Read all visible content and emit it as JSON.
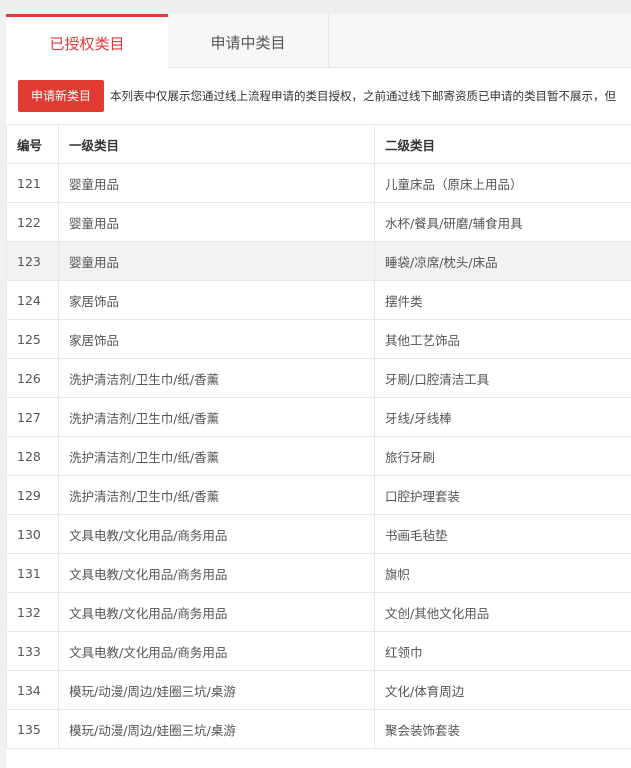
{
  "tabs": [
    {
      "label": "已授权类目",
      "active": true
    },
    {
      "label": "申请中类目",
      "active": false
    }
  ],
  "toolbar": {
    "apply_label": "申请新类目",
    "notice": "本列表中仅展示您通过线上流程申请的类目授权，之前通过线下邮寄资质已申请的类目暂不展示，但"
  },
  "table": {
    "headers": [
      "编号",
      "一级类目",
      "二级类目"
    ],
    "rows": [
      {
        "id": "121",
        "level1": "婴童用品",
        "level2": "儿童床品（原床上用品）"
      },
      {
        "id": "122",
        "level1": "婴童用品",
        "level2": "水杯/餐具/研磨/辅食用具"
      },
      {
        "id": "123",
        "level1": "婴童用品",
        "level2": "睡袋/凉席/枕头/床品"
      },
      {
        "id": "124",
        "level1": "家居饰品",
        "level2": "摆件类"
      },
      {
        "id": "125",
        "level1": "家居饰品",
        "level2": "其他工艺饰品"
      },
      {
        "id": "126",
        "level1": "洗护清洁剂/卫生巾/纸/香薰",
        "level2": "牙刷/口腔清洁工具"
      },
      {
        "id": "127",
        "level1": "洗护清洁剂/卫生巾/纸/香薰",
        "level2": "牙线/牙线棒"
      },
      {
        "id": "128",
        "level1": "洗护清洁剂/卫生巾/纸/香薰",
        "level2": "旅行牙刷"
      },
      {
        "id": "129",
        "level1": "洗护清洁剂/卫生巾/纸/香薰",
        "level2": "口腔护理套装"
      },
      {
        "id": "130",
        "level1": "文具电教/文化用品/商务用品",
        "level2": "书画毛毡垫"
      },
      {
        "id": "131",
        "level1": "文具电教/文化用品/商务用品",
        "level2": "旗帜"
      },
      {
        "id": "132",
        "level1": "文具电教/文化用品/商务用品",
        "level2": "文创/其他文化用品"
      },
      {
        "id": "133",
        "level1": "文具电教/文化用品/商务用品",
        "level2": "红领巾"
      },
      {
        "id": "134",
        "level1": "模玩/动漫/周边/娃圈三坑/桌游",
        "level2": "文化/体育周边"
      },
      {
        "id": "135",
        "level1": "模玩/动漫/周边/娃圈三坑/桌游",
        "level2": "聚会装饰套装"
      }
    ]
  },
  "colors": {
    "accent": "#e03a3a",
    "button_bg": "#e23b34",
    "highlight_row": "#f2f2f2"
  }
}
